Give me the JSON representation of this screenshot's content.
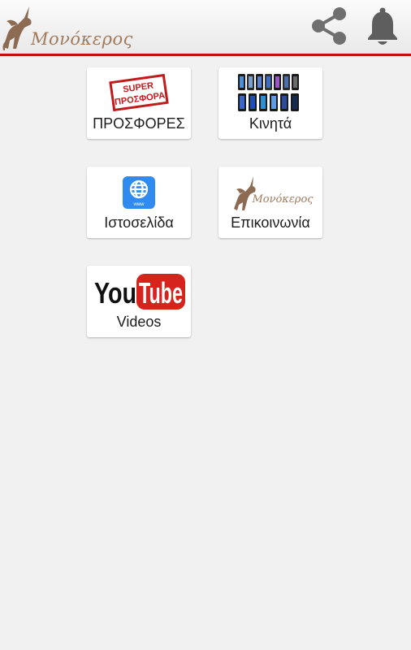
{
  "header": {
    "logo_text": "Μονόκερος",
    "share_icon": "share-icon",
    "notification_icon": "bell-icon",
    "accent_color": "#c40d12"
  },
  "tiles": [
    {
      "label": "ΠΡΟΣΦΟΡΕΣ",
      "icon": "super-offer-stamp-icon",
      "stamp_lines": [
        "SUPER",
        "ΠΡΟΣΦΟΡΑ"
      ]
    },
    {
      "label": "Κινητά",
      "icon": "smartphones-icon"
    },
    {
      "label": "Ιστοσελίδα",
      "icon": "website-globe-icon",
      "icon_text": "www"
    },
    {
      "label": "Επικοινωνία",
      "icon": "monokeros-logo-icon",
      "icon_text": "Μονόκερος"
    },
    {
      "label": "Videos",
      "icon": "youtube-logo-icon",
      "icon_text": [
        "You",
        "Tube"
      ]
    }
  ]
}
